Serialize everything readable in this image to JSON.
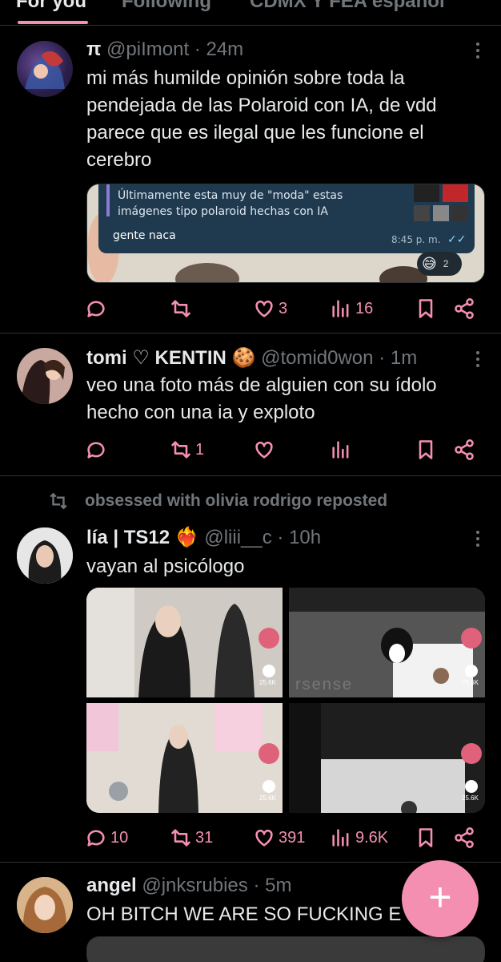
{
  "tabs": [
    {
      "label": "For you"
    },
    {
      "label": "Following"
    },
    {
      "label": "CDMX Y FEA español"
    }
  ],
  "posts": [
    {
      "name": "π",
      "handle": "@piImont",
      "time": "· 24m",
      "text": "mi más humilde opinión sobre toda la pendejada de las Polaroid con IA, de vdd parece que es ilegal que les funcione el cerebro",
      "embed": {
        "quoted_line1": "Últimamente esta muy de \"moda\" estas",
        "quoted_line2": "imágenes tipo polaroid hechas con IA",
        "message": "gente naca",
        "time": "8:45 p. m.",
        "reaction_count": "2"
      },
      "actions": {
        "replies": "",
        "reposts": "",
        "likes": "3",
        "views": "16"
      }
    },
    {
      "name": "tomi ♡ KENTIN 🍪",
      "handle": "@tomid0won",
      "time": "· 1m",
      "text": "veo una foto más de alguien con su ídolo hecho con una ia y exploto",
      "actions": {
        "replies": "",
        "reposts": "1",
        "likes": "",
        "views": ""
      }
    },
    {
      "repost_label": "obsessed with olivia rodrigo reposted",
      "name": "lía | TS12",
      "handle": "@liii__c",
      "time": "· 10h",
      "text": "vayan al psicólogo",
      "media_labels": [
        "25.6K",
        "25.6K",
        "25.6K",
        "25.6K"
      ],
      "watermark": "rsense",
      "actions": {
        "replies": "10",
        "reposts": "31",
        "likes": "391",
        "views": "9.6K"
      }
    },
    {
      "name": "angel",
      "handle": "@jnksrubies",
      "time": "· 5m",
      "text": "OH BITCH WE ARE SO FUCKING E"
    }
  ],
  "fab": {
    "label": "+"
  },
  "colors": {
    "accent": "#f48fb1",
    "background": "#000000",
    "muted": "#71767b",
    "divider": "#2f3336"
  }
}
